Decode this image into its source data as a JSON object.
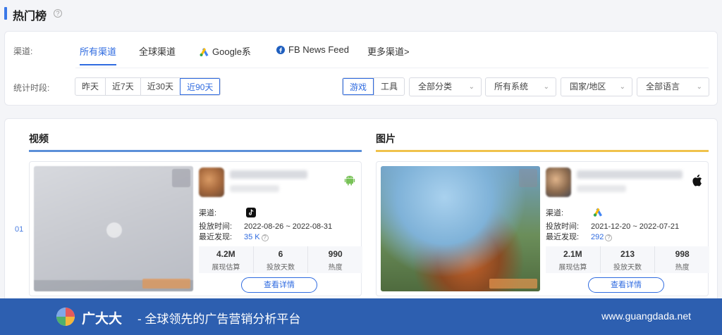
{
  "header": {
    "title": "热门榜",
    "help_icon": "question-icon"
  },
  "filters": {
    "channel_label": "渠道:",
    "channels": [
      {
        "label": "所有渠道",
        "active": true,
        "icon": ""
      },
      {
        "label": "全球渠道",
        "active": false,
        "icon": ""
      },
      {
        "label": "Google系",
        "active": false,
        "icon": "google-ads-icon"
      },
      {
        "label": "FB News Feed",
        "active": false,
        "icon": "facebook-icon"
      },
      {
        "label": "更多渠道>",
        "active": false,
        "icon": ""
      }
    ],
    "period_label": "统计时段:",
    "periods": [
      "昨天",
      "近7天",
      "近30天",
      "近90天"
    ],
    "period_selected": "近90天",
    "types": [
      "游戏",
      "工具"
    ],
    "type_selected": "游戏",
    "dropdowns": [
      "全部分类",
      "所有系统",
      "国家/地区",
      "全部语言"
    ]
  },
  "sections": {
    "video": {
      "title": "视频",
      "line_color": "#5b8fd8"
    },
    "image": {
      "title": "图片",
      "line_color": "#f0c24b"
    }
  },
  "rank": "01",
  "cards": {
    "video": {
      "os": "android-icon",
      "channel_label": "渠道:",
      "channel_icon": "tiktok-icon",
      "time_label": "投放时间:",
      "time_value": "2022-08-26 ~ 2022-08-31",
      "found_label": "最近发现:",
      "found_value": "35 K",
      "stats": [
        {
          "value": "4.2M",
          "label": "展现估算"
        },
        {
          "value": "6",
          "label": "投放天数"
        },
        {
          "value": "990",
          "label": "热度"
        }
      ],
      "detail": "查看详情"
    },
    "image": {
      "os": "apple-icon",
      "channel_label": "渠道:",
      "channel_icon": "google-ads-icon",
      "time_label": "投放时间:",
      "time_value": "2021-12-20 ~ 2022-07-21",
      "found_label": "最近发现:",
      "found_value": "292",
      "stats": [
        {
          "value": "2.1M",
          "label": "展现估算"
        },
        {
          "value": "213",
          "label": "投放天数"
        },
        {
          "value": "998",
          "label": "热度"
        }
      ],
      "detail": "查看详情"
    }
  },
  "footer": {
    "brand": "广大大",
    "slogan": "- 全球领先的广告营销分析平台",
    "url": "www.guangdada.net"
  }
}
